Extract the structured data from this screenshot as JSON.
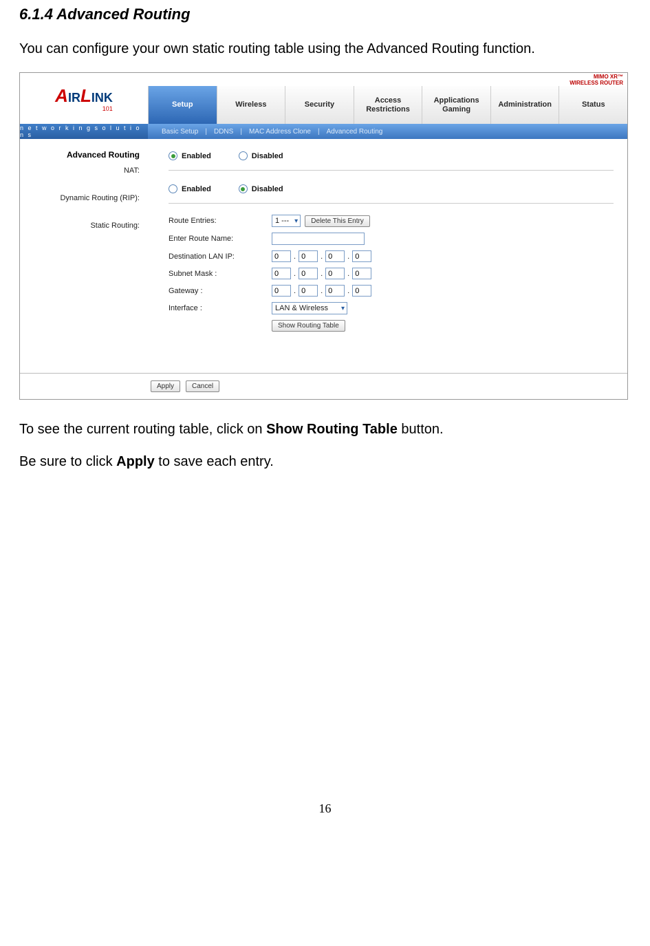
{
  "doc": {
    "heading": "6.1.4 Advanced Routing",
    "intro": "You can configure your own static routing table using the Advanced Routing function.",
    "para1_a": "To see the current routing table, click on ",
    "para1_b": "Show Routing Table",
    "para1_c": " button.",
    "para2_a": "Be sure to click ",
    "para2_b": "Apply",
    "para2_c": " to save each entry.",
    "page_number": "16"
  },
  "router": {
    "badge_line1": "MIMO XR™",
    "badge_line2": "WIRELESS ROUTER",
    "logo_text_a": "A",
    "logo_text_ir": "IR",
    "logo_text_l": "L",
    "logo_text_ink": "INK",
    "logo_sub": "101",
    "tagline": "n e t w o r k i n g s o l u t i o n s",
    "tabs": {
      "setup": "Setup",
      "wireless": "Wireless",
      "security": "Security",
      "access": "Access Restrictions",
      "apps": "Applications Gaming",
      "admin": "Administration",
      "status": "Status"
    },
    "subnav": {
      "basic": "Basic Setup",
      "ddns": "DDNS",
      "mac": "MAC Address Clone",
      "adv": "Advanced Routing"
    },
    "sidebar": {
      "title": "Advanced Routing",
      "nat": "NAT:",
      "rip": "Dynamic Routing (RIP):",
      "static": "Static Routing:"
    },
    "radio": {
      "enabled": "Enabled",
      "disabled": "Disabled"
    },
    "form": {
      "route_entries": "Route Entries:",
      "route_sel": "1 ---",
      "delete_btn": "Delete This Entry",
      "route_name": "Enter Route Name:",
      "dest_ip": "Destination LAN IP:",
      "subnet": "Subnet Mask :",
      "gateway": "Gateway :",
      "interface": "Interface :",
      "interface_sel": "LAN & Wireless",
      "show_btn": "Show Routing Table",
      "ip0": "0"
    },
    "footer": {
      "apply": "Apply",
      "cancel": "Cancel"
    }
  }
}
